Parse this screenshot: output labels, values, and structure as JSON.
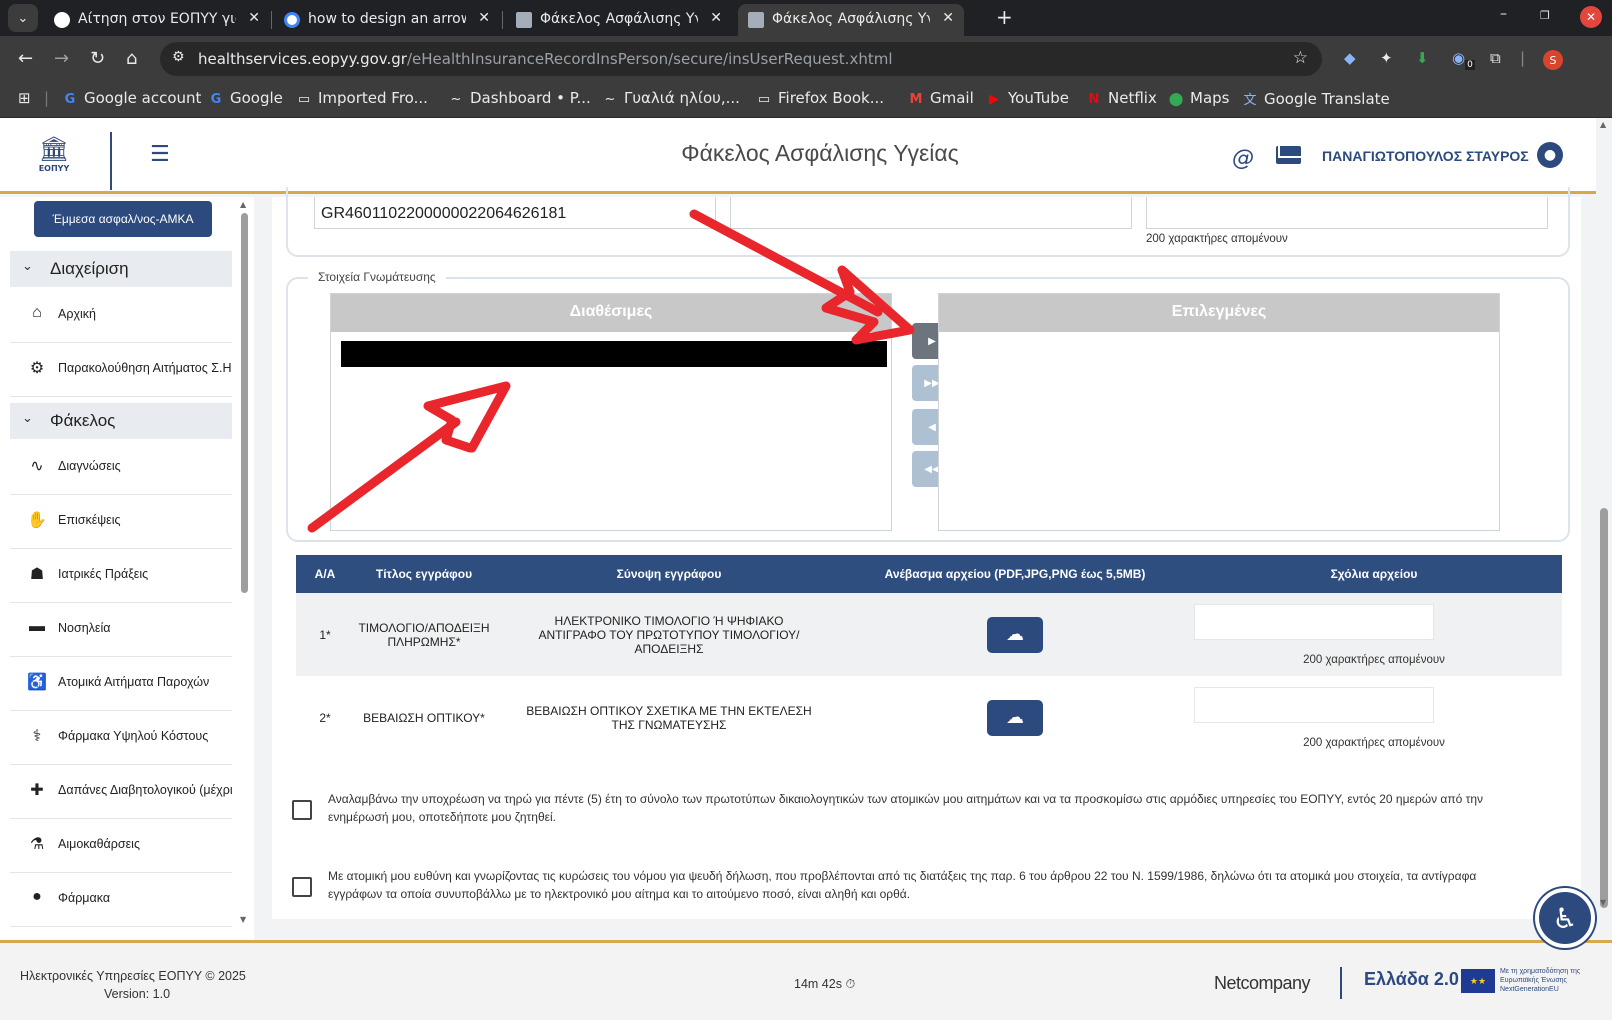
{
  "browser": {
    "tabs": [
      {
        "title": "Αίτηση στον ΕΟΠΥΥ για",
        "active": false
      },
      {
        "title": "how to design an arrow",
        "active": false
      },
      {
        "title": "Φάκελος Ασφάλισης Υγε",
        "active": false
      },
      {
        "title": "Φάκελος Ασφάλισης Υγε",
        "active": true
      }
    ],
    "new_tab": "+",
    "url_host": "healthservices.eopyy.gov.gr",
    "url_path": "/eHealthInsuranceRecordInsPerson/secure/insUserRequest.xhtml",
    "profile_initial": "S",
    "ext_badge": "0",
    "bookmarks": [
      {
        "label": "Google account",
        "icon": "G"
      },
      {
        "label": "Google",
        "icon": "G"
      },
      {
        "label": "Imported Fro...",
        "icon": "folder"
      },
      {
        "label": "Dashboard • P...",
        "icon": "~"
      },
      {
        "label": "Γυαλιά ηλίου,...",
        "icon": "~"
      },
      {
        "label": "Firefox Book...",
        "icon": "folder"
      },
      {
        "label": "Gmail",
        "icon": "M"
      },
      {
        "label": "YouTube",
        "icon": "▶"
      },
      {
        "label": "Netflix",
        "icon": "N"
      },
      {
        "label": "Maps",
        "icon": "pin"
      },
      {
        "label": "Google Translate",
        "icon": "文"
      }
    ]
  },
  "header": {
    "logo_text": "ΕΟΠΥΥ",
    "title": "Φάκελος Ασφάλισης Υγείας",
    "at_symbol": "@",
    "user_name": "ΠΑΝΑΓΙΩΤΟΠΟΥΛΟΣ ΣΤΑΥΡΟΣ"
  },
  "sidebar": {
    "amka_button": "Έμμεσα ασφαλ/νος-ΑΜΚΑ",
    "sections": [
      {
        "label": "Διαχείριση"
      },
      {
        "label": "Φάκελος"
      }
    ],
    "items": [
      {
        "label": "Αρχική",
        "icon": "home-icon",
        "glyph": "⌂"
      },
      {
        "label": "Παρακολούθηση Αιτήματος Σ.Η.",
        "icon": "gear-icon",
        "glyph": "⚙"
      },
      {
        "label": "Διαγνώσεις",
        "icon": "pulse-icon",
        "glyph": "∿"
      },
      {
        "label": "Επισκέψεις",
        "icon": "hand-icon",
        "glyph": "✋"
      },
      {
        "label": "Ιατρικές Πράξεις",
        "icon": "doctor-icon",
        "glyph": "☗"
      },
      {
        "label": "Νοσηλεία",
        "icon": "bed-icon",
        "glyph": "▬"
      },
      {
        "label": "Ατομικά Αιτήματα Παροχών",
        "icon": "wheelchair-icon",
        "glyph": "♿"
      },
      {
        "label": "Φάρμακα Υψηλού Κόστους",
        "icon": "pharmacy-icon",
        "glyph": "⚕"
      },
      {
        "label": "Δαπάνες Διαβητολογικού (μέχρι",
        "icon": "syringe-icon",
        "glyph": "✚"
      },
      {
        "label": "Αιμοκαθάρσεις",
        "icon": "dialysis-icon",
        "glyph": "⚗"
      },
      {
        "label": "Φάρμακα",
        "icon": "pills-icon",
        "glyph": "●"
      }
    ]
  },
  "form": {
    "iban_value": "GR4601102200000022064626181",
    "field3_count": "200 χαρακτήρες απομένουν",
    "opinion_legend": "Στοιχεία Γνωμάτευσης",
    "available_header": "Διαθέσιμες",
    "selected_header": "Επιλεγμένες",
    "move_buttons": [
      "▶",
      "▶▶",
      "◀",
      "◀◀"
    ]
  },
  "documents": {
    "columns": [
      "Α/Α",
      "Τίτλος εγγράφου",
      "Σύνοψη εγγράφου",
      "Ανέβασμα αρχείου (PDF,JPG,PNG έως 5,5MB)",
      "Σχόλια αρχείου"
    ],
    "rows": [
      {
        "num": "1*",
        "title": "ΤΙΜΟΛΟΓΙΟ/ΑΠΟΔΕΙΞΗ ΠΛΗΡΩΜΗΣ*",
        "summary": "ΗΛΕΚΤΡΟΝΙΚΟ ΤΙΜΟΛΟΓΙΟ Ή ΨΗΦΙΑΚΟ ΑΝΤΙΓΡΑΦΟ ΤΟΥ ΠΡΩΤΟΤΥΠΟΥ ΤΙΜΟΛΟΓΙΟΥ/ΑΠΟΔΕΙΞΗΣ",
        "count": "200 χαρακτήρες απομένουν"
      },
      {
        "num": "2*",
        "title": "ΒΕΒΑΙΩΣΗ ΟΠΤΙΚΟΥ*",
        "summary": "ΒΕΒΑΙΩΣΗ ΟΠΤΙΚΟΥ ΣΧΕΤΙΚΑ ΜΕ ΤΗΝ ΕΚΤΕΛΕΣΗ ΤΗΣ ΓΝΩΜΑΤΕΥΣΗΣ",
        "count": "200 χαρακτήρες απομένουν"
      }
    ]
  },
  "declarations": [
    "Αναλαμβάνω την υποχρέωση να τηρώ για πέντε (5) έτη το σύνολο των πρωτοτύπων δικαιολογητικών των ατομικών μου αιτημάτων και να τα προσκομίσω στις αρμόδιες υπηρεσίες του ΕΟΠΥΥ, εντός 20 ημερών από την ενημέρωσή μου, οποτεδήποτε μου ζητηθεί.",
    "Με ατομική μου ευθύνη και γνωρίζοντας τις κυρώσεις του νόμου για ψευδή δήλωση, που προβλέπονται από τις διατάξεις της παρ. 6 του άρθρου 22 του Ν. 1599/1986, δηλώνω ότι τα ατομικά μου στοιχεία, τα αντίγραφα εγγράφων τα οποία συνυποβάλλω με το ηλεκτρονικό μου αίτημα και το αιτούμενο ποσό, είναι αληθή και ορθά."
  ],
  "footer": {
    "copyright": "Ηλεκτρονικές Υπηρεσίες ΕΟΠΥΥ © 2025",
    "version": "Version: 1.0",
    "timer": "14m 42s",
    "company": "Netcompany",
    "ellada": "Ελλάδα 2.0",
    "eu_text": "Με τη χρηματοδότηση της Ευρωπαϊκής Ένωσης NextGenerationEU"
  },
  "colors": {
    "brand": "#2c4a7e",
    "accent": "#d8a94a",
    "annotation_arrow": "#e8262b"
  }
}
